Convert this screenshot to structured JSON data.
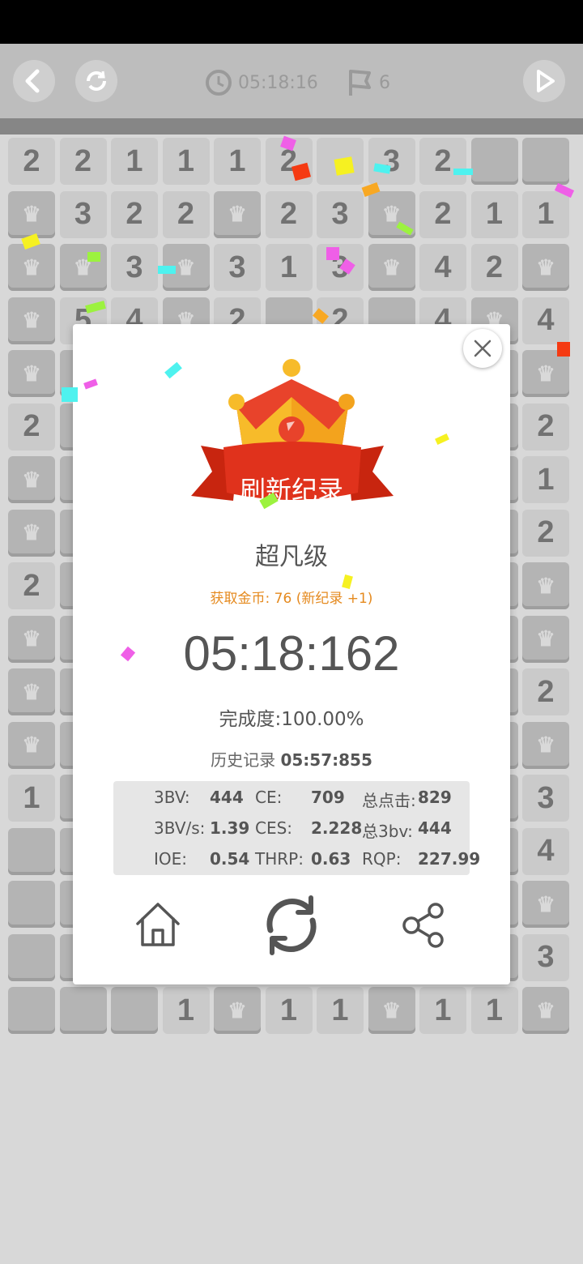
{
  "topbar": {
    "back_icon": "chevron-left-icon",
    "restart_icon": "refresh-icon",
    "timer_value": "05:18:16",
    "flag_count": "6",
    "play_icon": "play-icon"
  },
  "board": {
    "rows": [
      [
        "2",
        "2",
        "1",
        "1",
        "1",
        "2",
        "?",
        "3",
        "2",
        "",
        ""
      ],
      [
        "F",
        "3",
        "2",
        "2",
        "F",
        "2",
        "3",
        "F",
        "2",
        "1",
        "1"
      ],
      [
        "F",
        "F",
        "3",
        "F",
        "3",
        "1",
        "3",
        "F",
        "4",
        "2",
        "F"
      ],
      [
        "F",
        "5",
        "4",
        "F",
        "2",
        "",
        "2",
        "",
        "4",
        "F",
        "4"
      ],
      [
        "F",
        "",
        "",
        "",
        "",
        "",
        "",
        "",
        "",
        "",
        "F"
      ],
      [
        "2",
        "",
        "",
        "",
        "",
        "",
        "",
        "",
        "",
        "",
        "2"
      ],
      [
        "F",
        "",
        "",
        "",
        "",
        "",
        "",
        "",
        "",
        "",
        "1"
      ],
      [
        "F",
        "",
        "",
        "",
        "",
        "",
        "",
        "",
        "",
        "",
        "2"
      ],
      [
        "2",
        "",
        "",
        "",
        "",
        "",
        "",
        "",
        "",
        "",
        "F"
      ],
      [
        "F",
        "",
        "",
        "",
        "",
        "",
        "",
        "",
        "",
        "",
        "F"
      ],
      [
        "F",
        "",
        "",
        "",
        "",
        "",
        "",
        "",
        "",
        "",
        "2"
      ],
      [
        "F",
        "",
        "",
        "",
        "",
        "",
        "",
        "",
        "",
        "",
        "F"
      ],
      [
        "1",
        "",
        "",
        "",
        "",
        "",
        "",
        "",
        "",
        "",
        "3"
      ],
      [
        "",
        "",
        "",
        "",
        "",
        "",
        "",
        "",
        "",
        "",
        "4"
      ],
      [
        "",
        "",
        "",
        "",
        "",
        "",
        "",
        "",
        "",
        "",
        "F"
      ],
      [
        "",
        "",
        "",
        "",
        "",
        "",
        "",
        "",
        "",
        "",
        "3"
      ],
      [
        "",
        "",
        "",
        "1",
        "F",
        "1",
        "1",
        "F",
        "1",
        "1",
        "F"
      ]
    ]
  },
  "dialog": {
    "banner": "刷新纪录",
    "level": "超凡级",
    "coins": "获取金币: 76 (新纪录 +1)",
    "time": "05:18:162",
    "completion": "完成度:100.00%",
    "history_label": "历史记录",
    "history_value": "05:57:855",
    "stats": [
      [
        [
          "3BV:",
          "444"
        ],
        [
          "CE:",
          "709"
        ],
        [
          "总点击:",
          "829"
        ]
      ],
      [
        [
          "3BV/s:",
          "1.39"
        ],
        [
          "CES:",
          "2.228"
        ],
        [
          "总3bv:",
          "444"
        ]
      ],
      [
        [
          "IOE:",
          "0.54"
        ],
        [
          "THRP:",
          "0.63"
        ],
        [
          "RQP:",
          "227.99"
        ]
      ]
    ],
    "actions": [
      "home-icon",
      "replay-icon",
      "share-icon"
    ]
  },
  "colors": {
    "crown_red": "#e8432b",
    "crown_gold": "#f7bb2a",
    "ribbon_red": "#e0321c",
    "coins_orange": "#e58a1f"
  }
}
